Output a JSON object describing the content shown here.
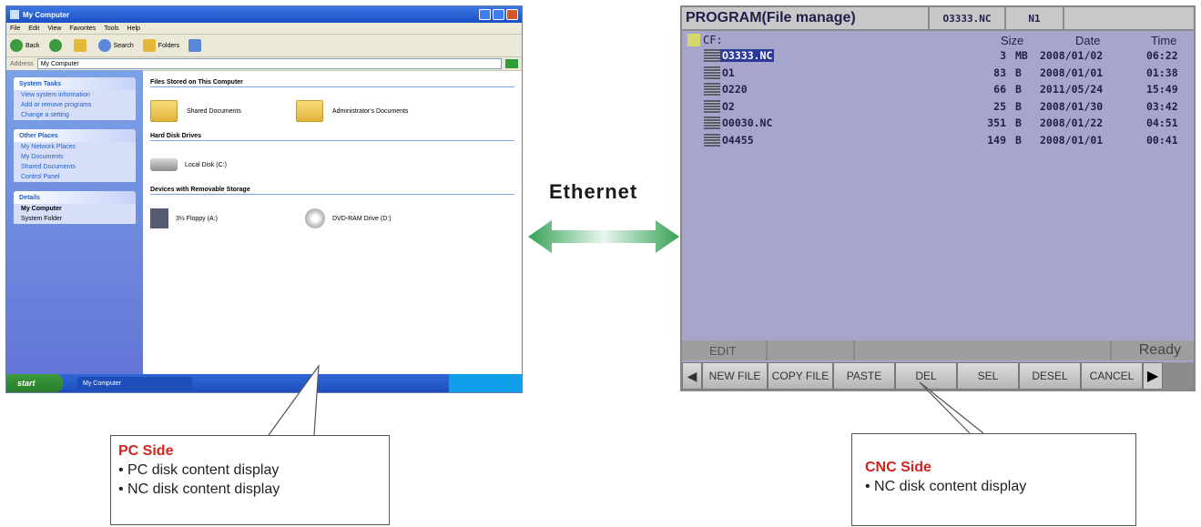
{
  "ethernet_label": "Ethernet",
  "colors": {
    "arrow_start": "#35a255",
    "arrow_mid": "#e8f6ef",
    "callout_title": "#d0241e"
  },
  "pc": {
    "window_title": "My Computer",
    "menu": [
      "File",
      "Edit",
      "View",
      "Favorites",
      "Tools",
      "Help"
    ],
    "toolbar": {
      "back": "Back",
      "search": "Search",
      "folders": "Folders"
    },
    "address_label": "Address",
    "address_value": "My Computer",
    "side_panels": [
      {
        "title": "System Tasks",
        "items": [
          "View system information",
          "Add or remove programs",
          "Change a setting"
        ]
      },
      {
        "title": "Other Places",
        "items": [
          "My Network Places",
          "My Documents",
          "Shared Documents",
          "Control Panel"
        ]
      },
      {
        "title": "Details",
        "items": [
          "My Computer",
          "System Folder"
        ]
      }
    ],
    "sections": {
      "stored": "Files Stored on This Computer",
      "hdd": "Hard Disk Drives",
      "removable": "Devices with Removable Storage"
    },
    "stored_items": [
      "Shared Documents",
      "Administrator's Documents"
    ],
    "hdd_items": [
      "Local Disk (C:)"
    ],
    "removable_items": [
      "3½ Floppy (A:)",
      "DVD-RAM Drive (D:)"
    ],
    "start_label": "start",
    "task_label": "My Computer"
  },
  "cnc": {
    "title": "PROGRAM(File manage)",
    "current_file": "O3333.NC",
    "n_number": "N1",
    "drive": "CF:",
    "headers": {
      "size": "Size",
      "date": "Date",
      "time": "Time"
    },
    "files": [
      {
        "name": "O3333.NC",
        "size": "3",
        "unit": "MB",
        "date": "2008/01/02",
        "time": "06:22",
        "selected": true
      },
      {
        "name": "O1",
        "size": "83",
        "unit": "B",
        "date": "2008/01/01",
        "time": "01:38",
        "selected": false
      },
      {
        "name": "O220",
        "size": "66",
        "unit": "B",
        "date": "2011/05/24",
        "time": "15:49",
        "selected": false
      },
      {
        "name": "O2",
        "size": "25",
        "unit": "B",
        "date": "2008/01/30",
        "time": "03:42",
        "selected": false
      },
      {
        "name": "O0030.NC",
        "size": "351",
        "unit": "B",
        "date": "2008/01/22",
        "time": "04:51",
        "selected": false
      },
      {
        "name": "O4455",
        "size": "149",
        "unit": "B",
        "date": "2008/01/01",
        "time": "00:41",
        "selected": false
      }
    ],
    "status_mode": "EDIT",
    "status_ready": "Ready",
    "softkeys": [
      "NEW FILE",
      "COPY FILE",
      "PASTE",
      "DEL",
      "SEL",
      "DESEL",
      "CANCEL"
    ]
  },
  "callouts": {
    "pc": {
      "title": "PC Side",
      "lines": [
        "• PC disk content display",
        "• NC disk content display"
      ]
    },
    "cnc": {
      "title": "CNC Side",
      "lines": [
        "• NC disk content display"
      ]
    }
  }
}
